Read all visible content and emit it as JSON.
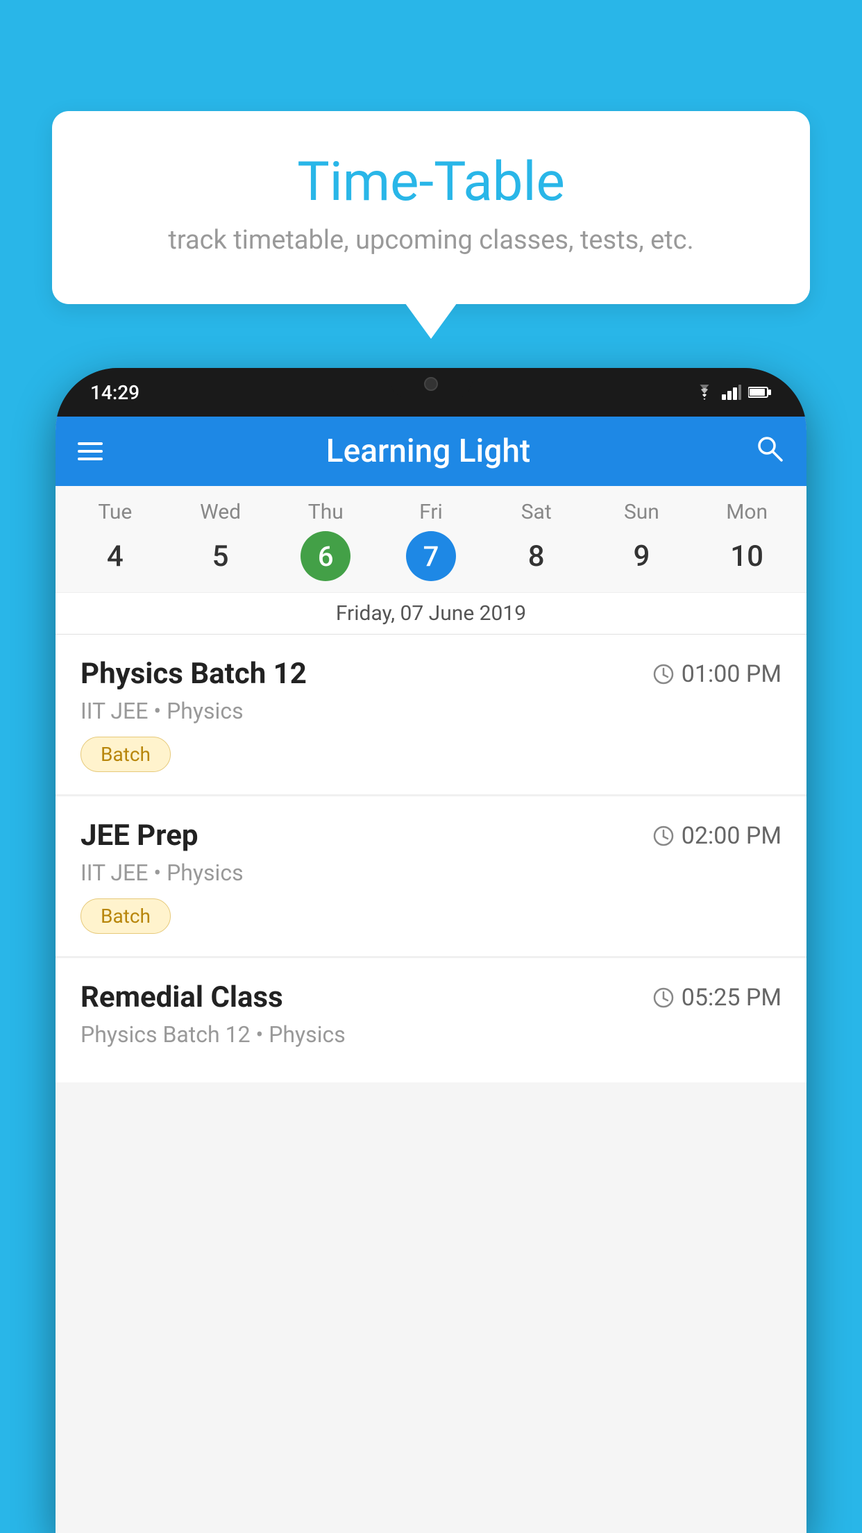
{
  "background_color": "#29b6e8",
  "tooltip": {
    "title": "Time-Table",
    "subtitle": "track timetable, upcoming classes, tests, etc."
  },
  "phone": {
    "time": "14:29",
    "status_icons": [
      "wifi",
      "signal",
      "battery"
    ]
  },
  "app": {
    "title": "Learning Light",
    "menu_icon": "hamburger-icon",
    "search_icon": "search-icon"
  },
  "calendar": {
    "days": [
      "Tue",
      "Wed",
      "Thu",
      "Fri",
      "Sat",
      "Sun",
      "Mon"
    ],
    "dates": [
      {
        "date": "4",
        "state": "normal"
      },
      {
        "date": "5",
        "state": "normal"
      },
      {
        "date": "6",
        "state": "today"
      },
      {
        "date": "7",
        "state": "selected"
      },
      {
        "date": "8",
        "state": "normal"
      },
      {
        "date": "9",
        "state": "normal"
      },
      {
        "date": "10",
        "state": "normal"
      }
    ],
    "selected_date_label": "Friday, 07 June 2019"
  },
  "schedule": [
    {
      "title": "Physics Batch 12",
      "time": "01:00 PM",
      "subtitle": "IIT JEE • Physics",
      "badge": "Batch"
    },
    {
      "title": "JEE Prep",
      "time": "02:00 PM",
      "subtitle": "IIT JEE • Physics",
      "badge": "Batch"
    },
    {
      "title": "Remedial Class",
      "time": "05:25 PM",
      "subtitle": "Physics Batch 12 • Physics",
      "badge": ""
    }
  ]
}
